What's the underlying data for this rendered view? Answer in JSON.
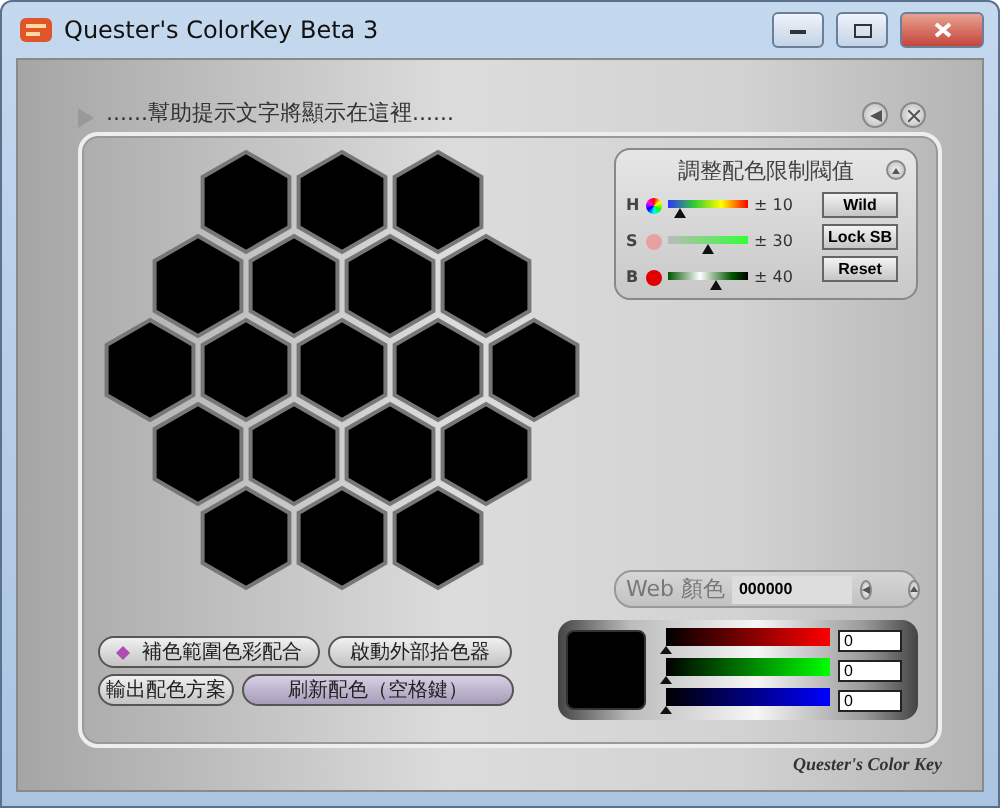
{
  "window": {
    "title": "Quester's ColorKey Beta 3"
  },
  "hint": {
    "text": "......幫助提示文字將顯示在這裡......"
  },
  "swatches": [
    {
      "color": "#000000"
    },
    {
      "color": "#000000"
    },
    {
      "color": "#000000"
    },
    {
      "color": "#000000"
    },
    {
      "color": "#000000"
    },
    {
      "color": "#000000"
    },
    {
      "color": "#000000"
    },
    {
      "color": "#000000"
    },
    {
      "color": "#000000"
    },
    {
      "color": "#000000"
    },
    {
      "color": "#000000"
    },
    {
      "color": "#000000"
    },
    {
      "color": "#000000"
    },
    {
      "color": "#000000"
    },
    {
      "color": "#000000"
    },
    {
      "color": "#000000"
    },
    {
      "color": "#000000"
    },
    {
      "color": "#000000"
    },
    {
      "color": "#000000"
    }
  ],
  "threshold": {
    "title": "調整配色限制閥值",
    "rows": [
      {
        "label": "H",
        "kind": "hue",
        "level": 0.15,
        "reading": "± 10"
      },
      {
        "label": "S",
        "kind": "saturation",
        "level": 0.5,
        "reading": "± 30"
      },
      {
        "label": "B",
        "kind": "brightness",
        "level": 0.6,
        "reading": "± 40"
      }
    ],
    "buttons": [
      "Wild",
      "Lock SB",
      "Reset"
    ]
  },
  "web_color": {
    "label": "Web 顏色",
    "value": "000000"
  },
  "actions": [
    {
      "label": "補色範圍色彩配合",
      "kind": "marked"
    },
    {
      "label": "啟動外部拾色器",
      "kind": "plain"
    },
    {
      "label": "輸出配色方案",
      "kind": "plain"
    },
    {
      "label": "刷新配色（空格鍵）",
      "kind": "accent"
    }
  ],
  "preview": {
    "color": "#000000"
  },
  "rgb": [
    {
      "kind": "red",
      "level": 0,
      "value": "0"
    },
    {
      "kind": "green",
      "level": 0,
      "value": "0"
    },
    {
      "kind": "blue",
      "level": 0,
      "value": "0"
    }
  ],
  "footer": "Quester's Color Key"
}
